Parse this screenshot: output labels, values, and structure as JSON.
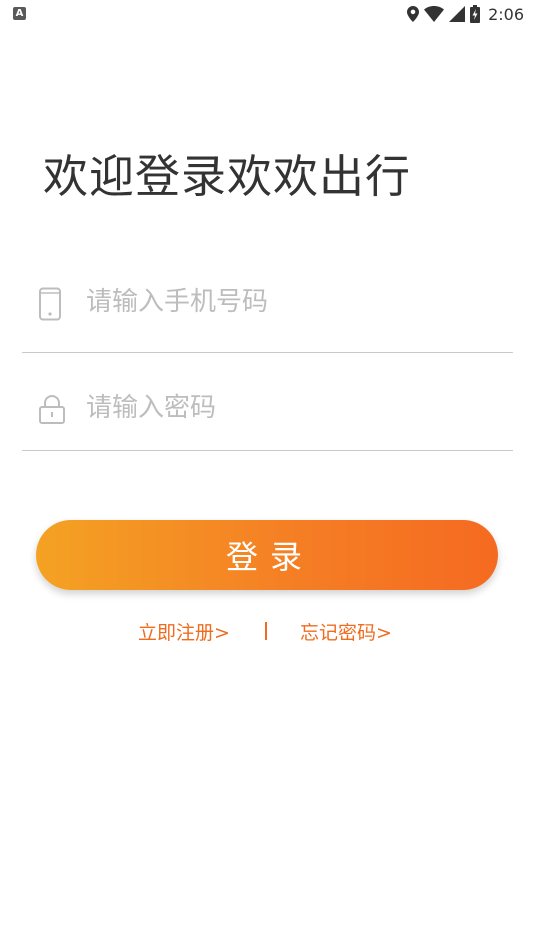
{
  "status_bar": {
    "app_icon_letter": "A",
    "time": "2:06",
    "icons": [
      "location-icon",
      "wifi-icon",
      "signal-icon",
      "battery-charging-icon"
    ]
  },
  "welcome": {
    "title": "欢迎登录欢欢出行"
  },
  "form": {
    "phone": {
      "placeholder": "请输入手机号码",
      "value": "",
      "icon": "phone-icon"
    },
    "password": {
      "placeholder": "请输入密码",
      "value": "",
      "icon": "lock-icon"
    }
  },
  "login_button": {
    "label": "登录"
  },
  "links": {
    "register": "立即注册>",
    "forgot_password": "忘记密码>"
  },
  "colors": {
    "accent": "#f06b1e",
    "button_gradient_start": "#f4a223",
    "button_gradient_end": "#f56a21",
    "placeholder": "#bdbdbd",
    "title": "#333333"
  }
}
